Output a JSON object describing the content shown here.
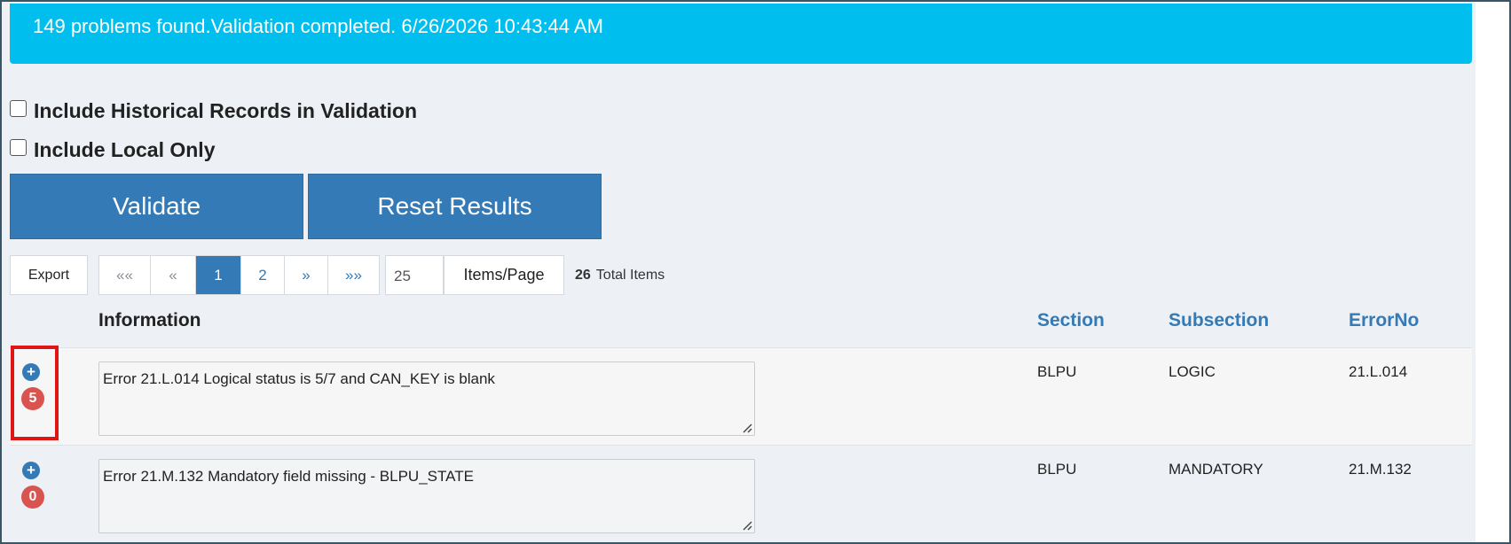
{
  "banner": {
    "message": "149 problems found.Validation completed. 6/26/2026 10:43:44 AM"
  },
  "options": {
    "historical_label": "Include Historical Records in Validation",
    "local_only_label": "Include Local Only"
  },
  "actions": {
    "validate_label": "Validate",
    "reset_label": "Reset Results"
  },
  "toolbar": {
    "export_label": "Export",
    "pager": {
      "first": "««",
      "prev": "«",
      "pages": [
        "1",
        "2"
      ],
      "current": "1",
      "next": "»",
      "last": "»»"
    },
    "items_per_page_value": "25",
    "items_per_page_label": "Items/Page",
    "total_count": "26",
    "total_label": "Total Items"
  },
  "table": {
    "headers": {
      "information": "Information",
      "section": "Section",
      "subsection": "Subsection",
      "errorno": "ErrorNo"
    },
    "rows": [
      {
        "plus": "+",
        "count": "5",
        "information": "Error 21.L.014 Logical status is 5/7 and CAN_KEY is blank",
        "section": "BLPU",
        "subsection": "LOGIC",
        "errorno": "21.L.014"
      },
      {
        "plus": "+",
        "count": "0",
        "information": "Error 21.M.132 Mandatory field missing - BLPU_STATE",
        "section": "BLPU",
        "subsection": "MANDATORY",
        "errorno": "21.M.132"
      }
    ]
  },
  "colors": {
    "banner": "#00bfee",
    "primary": "#337ab7",
    "badge": "#d9534f",
    "highlight": "#e01515"
  }
}
